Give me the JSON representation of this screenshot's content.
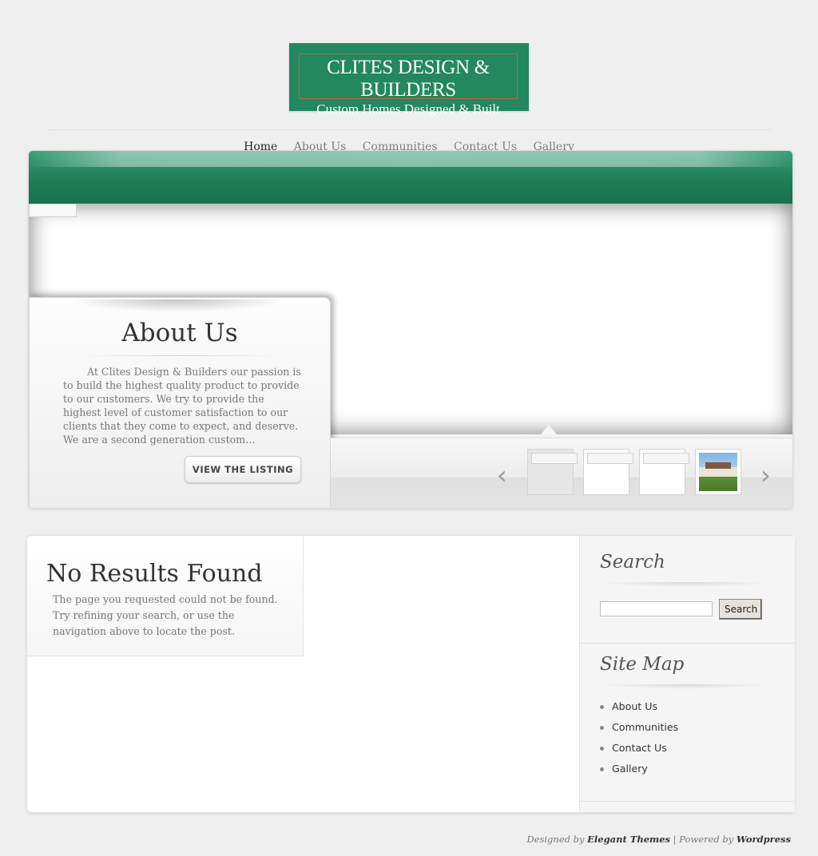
{
  "logo": {
    "line1": "CLITES DESIGN & BUILDERS",
    "line2": "Custom Homes Designed & Built"
  },
  "nav": {
    "items": [
      "Home",
      "About Us",
      "Communities",
      "Contact Us",
      "Gallery"
    ],
    "active": "Home"
  },
  "featured": {
    "about_title": "About Us",
    "about_text": "At Clites Design & Builders our passion is to build the highest quality product to provide to our customers. We try to provide the highest level of customer satisfaction to our clients that they come to expect, and deserve. We are a second generation custom…",
    "button_label": "VIEW THE LISTING",
    "prev_arrow": "‹",
    "next_arrow": "›",
    "thumbnails": [
      "empty",
      "empty",
      "empty",
      "house-photo"
    ]
  },
  "content": {
    "title": "No Results Found",
    "text": "The page you requested could not be found. Try refining your search, or use the navigation above to locate the post."
  },
  "sidebar": {
    "search_title": "Search",
    "search_value": "",
    "search_button": "Search",
    "sitemap_title": "Site Map",
    "sitemap_items": [
      "About Us",
      "Communities",
      "Contact Us",
      "Gallery"
    ]
  },
  "footer": {
    "designed_by": "Designed by",
    "designer": "Elegant Themes",
    "separator": " | Powered by ",
    "powered": "Wordpress"
  },
  "colors": {
    "brand_green": "#23875f",
    "logo_border": "#b9644a",
    "background": "#efefef"
  }
}
